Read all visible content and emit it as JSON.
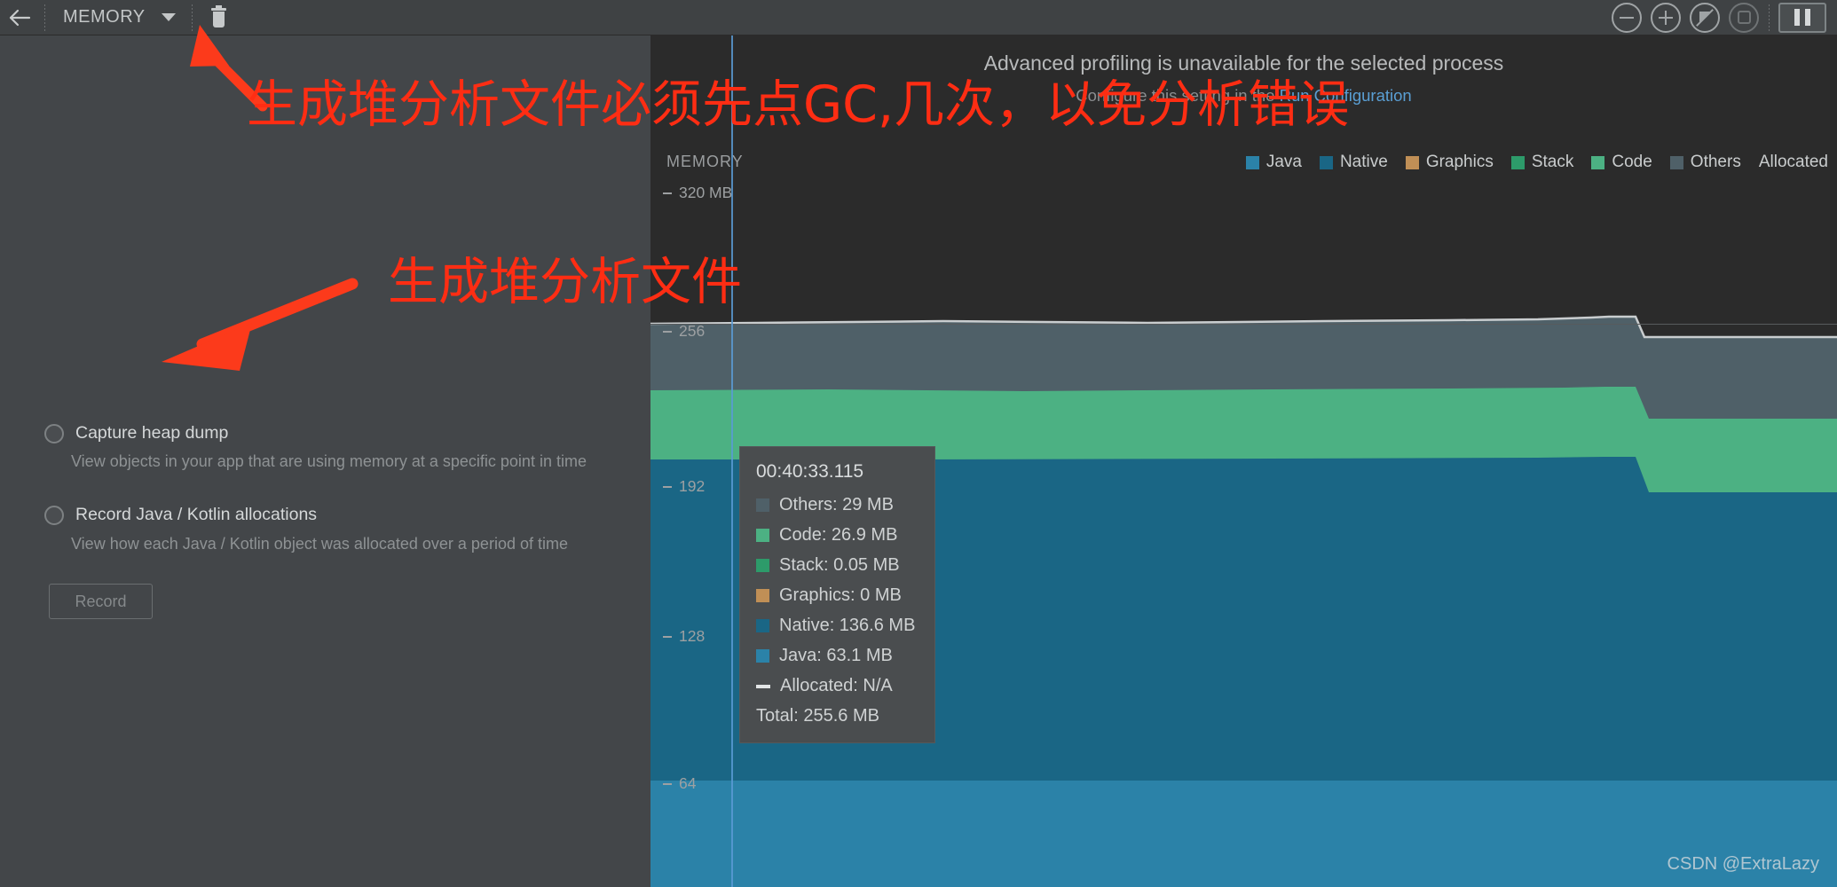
{
  "toolbar": {
    "back_icon": "back-arrow-icon",
    "profiler_name": "MEMORY",
    "dropdown_icon": "chevron-down-icon",
    "gc_icon": "trash-can-icon",
    "zoom_out_icon": "zoom-out-icon",
    "zoom_in_icon": "zoom-in-icon",
    "reset_zoom_icon": "reset-zoom-icon",
    "attach_live_icon": "attach-to-live-icon",
    "pause_icon": "pause-icon"
  },
  "left_panel": {
    "options": [
      {
        "title": "Capture heap dump",
        "description": "View objects in your app that are using memory at a specific point in time",
        "selected": false
      },
      {
        "title": "Record Java / Kotlin allocations",
        "description": "View how each Java / Kotlin object was allocated over a period of time",
        "selected": false
      }
    ],
    "record_button": "Record"
  },
  "banner": {
    "line1": "Advanced profiling is unavailable for the selected process",
    "line2_prefix": "Configure this setting in the ",
    "line2_link": "Run Configuration",
    "link_color": "#5a9fd4"
  },
  "legend": {
    "items": [
      {
        "label": "Java",
        "color": "#2b82a8",
        "type": "swatch"
      },
      {
        "label": "Native",
        "color": "#1a6685",
        "type": "swatch"
      },
      {
        "label": "Graphics",
        "color": "#c08f56",
        "type": "swatch"
      },
      {
        "label": "Stack",
        "color": "#2d9b6a",
        "type": "swatch"
      },
      {
        "label": "Code",
        "color": "#4cb183",
        "type": "swatch"
      },
      {
        "label": "Others",
        "color": "#4f6068",
        "type": "swatch"
      },
      {
        "label": "Allocated",
        "color": "#d8dbdc",
        "type": "dash"
      }
    ]
  },
  "chart_data": {
    "type": "area",
    "title": "MEMORY",
    "ylabel": "MB",
    "xlabel": "",
    "ylim": [
      0,
      352
    ],
    "grid": true,
    "legend_position": "top-right",
    "axis_label_top": "320 MB",
    "ticks": [
      {
        "value": 320,
        "label": "320 MB"
      },
      {
        "value": 256,
        "label": "256"
      },
      {
        "value": 192,
        "label": "192"
      },
      {
        "value": 128,
        "label": "128"
      },
      {
        "value": 64,
        "label": "64"
      }
    ],
    "selection_time": "00:40:33.115",
    "series": [
      {
        "name": "Java",
        "color": "#2b82a8",
        "value_at_selection": 63.1,
        "unit": "MB"
      },
      {
        "name": "Native",
        "color": "#1a6685",
        "value_at_selection": 136.6,
        "unit": "MB"
      },
      {
        "name": "Graphics",
        "color": "#c08f56",
        "value_at_selection": 0,
        "unit": "MB"
      },
      {
        "name": "Stack",
        "color": "#2d9b6a",
        "value_at_selection": 0.05,
        "unit": "MB"
      },
      {
        "name": "Code",
        "color": "#4cb183",
        "value_at_selection": 26.9,
        "unit": "MB"
      },
      {
        "name": "Others",
        "color": "#4f6068",
        "value_at_selection": 29,
        "unit": "MB"
      },
      {
        "name": "Allocated",
        "color": "#d8dbdc",
        "value_at_selection": "N/A",
        "unit": ""
      }
    ],
    "total_at_selection": 255.6,
    "total_unit": "MB"
  },
  "tooltip": {
    "time": "00:40:33.115",
    "rows": [
      {
        "label": "Others: 29 MB",
        "color": "#4f6068",
        "marker": "square"
      },
      {
        "label": "Code: 26.9 MB",
        "color": "#4cb183",
        "marker": "square"
      },
      {
        "label": "Stack: 0.05 MB",
        "color": "#2d9b6a",
        "marker": "square"
      },
      {
        "label": "Graphics: 0 MB",
        "color": "#c08f56",
        "marker": "square"
      },
      {
        "label": "Native: 136.6 MB",
        "color": "#1a6685",
        "marker": "square"
      },
      {
        "label": "Java: 63.1 MB",
        "color": "#2b82a8",
        "marker": "square"
      },
      {
        "label": "Allocated: N/A",
        "color": "#e2e5e6",
        "marker": "dash"
      }
    ],
    "total": "Total: 255.6 MB"
  },
  "annotations": {
    "red_color": "#ff2d13",
    "text1": "生成堆分析文件必须先点GC,几次，以免分析错误",
    "text2": "生成堆分析文件",
    "arrow1_target": "gc-trash-button",
    "arrow2_target": "capture-heap-dump-option"
  },
  "watermark": "CSDN @ExtraLazy"
}
